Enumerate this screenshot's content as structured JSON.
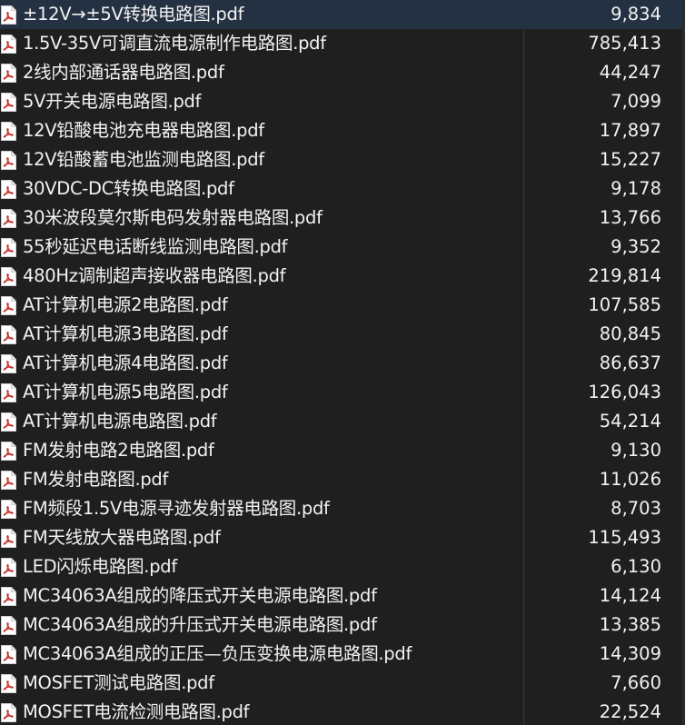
{
  "files": [
    {
      "name": "±12V→±5V转换电路图.pdf",
      "size": "9,834"
    },
    {
      "name": "1.5V-35V可调直流电源制作电路图.pdf",
      "size": "785,413"
    },
    {
      "name": "2线内部通话器电路图.pdf",
      "size": "44,247"
    },
    {
      "name": "5V开关电源电路图.pdf",
      "size": "7,099"
    },
    {
      "name": "12V铅酸电池充电器电路图.pdf",
      "size": "17,897"
    },
    {
      "name": "12V铅酸蓄电池监测电路图.pdf",
      "size": "15,227"
    },
    {
      "name": "30VDC-DC转换电路图.pdf",
      "size": "9,178"
    },
    {
      "name": "30米波段莫尔斯电码发射器电路图.pdf",
      "size": "13,766"
    },
    {
      "name": "55秒延迟电话断线监测电路图.pdf",
      "size": "9,352"
    },
    {
      "name": "480Hz调制超声接收器电路图.pdf",
      "size": "219,814"
    },
    {
      "name": "AT计算机电源2电路图.pdf",
      "size": "107,585"
    },
    {
      "name": "AT计算机电源3电路图.pdf",
      "size": "80,845"
    },
    {
      "name": "AT计算机电源4电路图.pdf",
      "size": "86,637"
    },
    {
      "name": "AT计算机电源5电路图.pdf",
      "size": "126,043"
    },
    {
      "name": "AT计算机电源电路图.pdf",
      "size": "54,214"
    },
    {
      "name": "FM发射电路2电路图.pdf",
      "size": "9,130"
    },
    {
      "name": "FM发射电路图.pdf",
      "size": "11,026"
    },
    {
      "name": "FM频段1.5V电源寻迹发射器电路图.pdf",
      "size": "8,703"
    },
    {
      "name": "FM天线放大器电路图.pdf",
      "size": "115,493"
    },
    {
      "name": "LED闪烁电路图.pdf",
      "size": "6,130"
    },
    {
      "name": "MC34063A组成的降压式开关电源电路图.pdf",
      "size": "14,124"
    },
    {
      "name": "MC34063A组成的升压式开关电源电路图.pdf",
      "size": "13,385"
    },
    {
      "name": "MC34063A组成的正压—负压变换电源电路图.pdf",
      "size": "14,309"
    },
    {
      "name": "MOSFET测试电路图.pdf",
      "size": "7,660"
    },
    {
      "name": "MOSFET电流检测电路图.pdf",
      "size": "22,524"
    }
  ],
  "selected_index": 0,
  "icon": "pdf-file-icon",
  "colors": {
    "background": "#1f1f1f",
    "selected_row": "#243142",
    "icon_red": "#c4302b",
    "text": "#f2f2f2"
  }
}
